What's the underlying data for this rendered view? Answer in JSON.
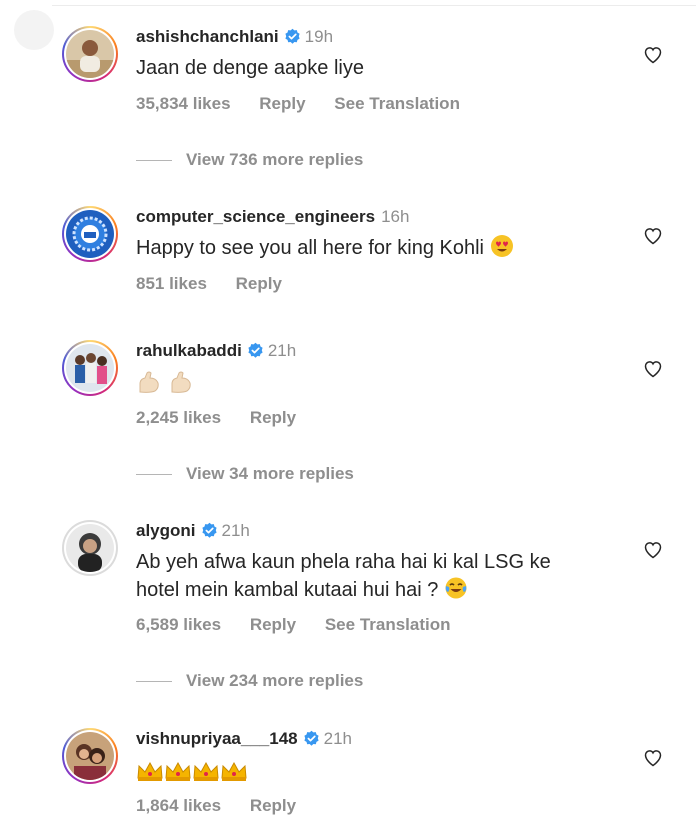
{
  "comments": [
    {
      "username": "ashishchanchlani",
      "verified": true,
      "time": "19h",
      "text": "Jaan de denge aapke liye",
      "likes": "35,834 likes",
      "reply": "Reply",
      "translation": "See Translation",
      "view_replies": "View 736 more replies"
    },
    {
      "username": "computer_science_engineers",
      "verified": false,
      "time": "16h",
      "text": "Happy to see you all here for king Kohli",
      "likes": "851 likes",
      "reply": "Reply"
    },
    {
      "username": "rahulkabaddi",
      "verified": true,
      "time": "21h",
      "text": "",
      "likes": "2,245 likes",
      "reply": "Reply",
      "view_replies": "View 34 more replies"
    },
    {
      "username": "alygoni",
      "verified": true,
      "time": "21h",
      "text_line1": "Ab yeh afwa kaun phela raha hai ki kal LSG ke",
      "text_line2": "hotel mein kambal kutaai hui hai ?",
      "likes": "6,589 likes",
      "reply": "Reply",
      "translation": "See Translation",
      "view_replies": "View 234 more replies"
    },
    {
      "username": "vishnupriyaa___148",
      "verified": true,
      "time": "21h",
      "text": "",
      "likes": "1,864 likes",
      "reply": "Reply"
    }
  ],
  "icons": {
    "verified": "verified-badge-icon",
    "like": "heart-outline-icon",
    "emoji_heart_eyes": "heart-eyes-emoji",
    "emoji_flexed_bicep": "flexed-biceps-emoji",
    "emoji_joy": "tears-of-joy-emoji",
    "emoji_crown": "crown-emoji"
  },
  "colors": {
    "verified": "#3897f0",
    "muted": "#8e8e8e",
    "text": "#262626"
  }
}
